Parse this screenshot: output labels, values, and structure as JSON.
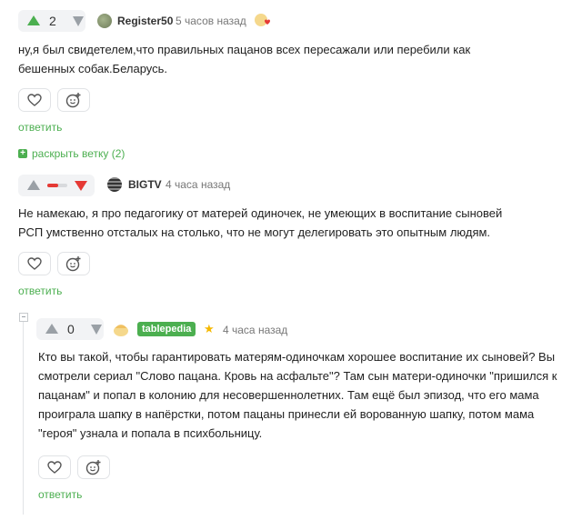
{
  "comments": [
    {
      "score": "2",
      "user": "Register50",
      "time": "5 часов назад",
      "text_lines": [
        "ну,я был свидетелем,что правильных пацанов всех пересажали или перебили как",
        "бешенных собак.Беларусь."
      ],
      "reply": "ответить",
      "expand": "раскрыть ветку (2)"
    },
    {
      "user": "BIGTV",
      "time": "4 часа назад",
      "text_lines": [
        "Не намекаю, я про педагогику от матерей одиночек, не умеющих в воспитание сыновей",
        "РСП умственно отсталых на столько, что не могут делегировать это опытным людям."
      ],
      "reply": "ответить"
    },
    {
      "score": "0",
      "user": "tablepedia",
      "time": "4 часа назад",
      "text_lines": [
        "Кто вы такой, чтобы гарантировать матерям-одиночкам хорошее воспитание их сыновей? Вы",
        "смотрели сериал \"Слово пацана. Кровь на асфальте\"? Там сын матери-одиночки \"пришился к",
        "пацанам\" и попал в колонию для несовершеннолетних. Там ещё был эпизод, что его мама",
        "проиграла шапку в напёрстки, потом пацаны принесли ей ворованную шапку, потом мама",
        "\"героя\" узнала и попала в психбольницу."
      ],
      "reply": "ответить"
    }
  ],
  "colors": {
    "accent": "#4caf50",
    "down": "#e53935"
  }
}
